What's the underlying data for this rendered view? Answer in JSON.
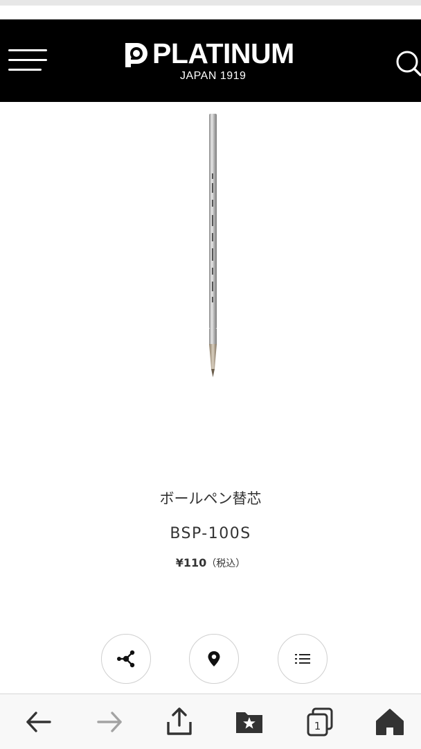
{
  "brand": {
    "name": "PLATINUM",
    "tagline": "JAPAN 1919",
    "header_bg": "#000000",
    "text_color": "#ffffff"
  },
  "product": {
    "name": "ボールペン替芯",
    "code": "BSP-100S",
    "price": "¥110",
    "tax_note": "（税込）",
    "image": "ballpoint-refill-image"
  },
  "actions": [
    {
      "icon": "share-icon"
    },
    {
      "icon": "location-pin-icon"
    },
    {
      "icon": "list-icon"
    }
  ],
  "browser_toolbar": {
    "tab_count": "1",
    "icons": [
      "back-arrow-icon",
      "forward-arrow-icon",
      "share-upload-icon",
      "bookmarks-icon",
      "tabs-icon",
      "home-icon"
    ]
  }
}
